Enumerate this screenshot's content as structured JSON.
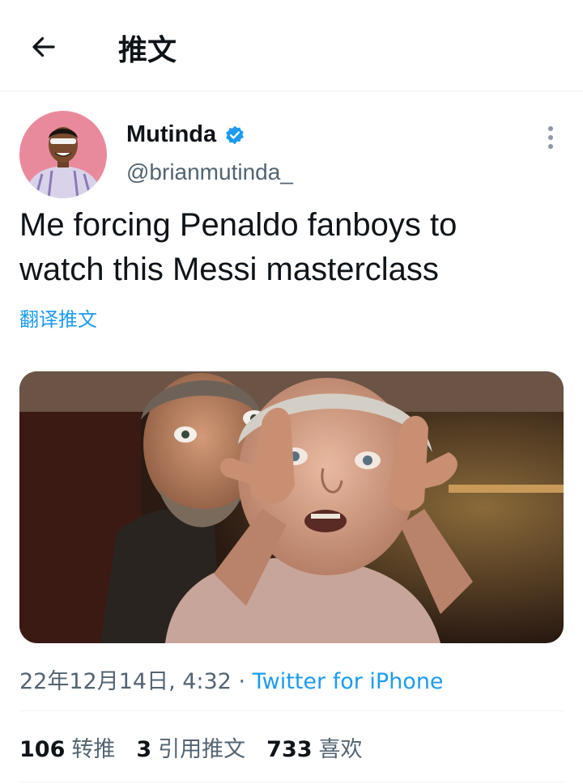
{
  "header": {
    "title": "推文",
    "back_icon": "arrow-left-icon"
  },
  "tweet": {
    "author": {
      "name": "Mutinda",
      "handle": "@brianmutinda_",
      "verified": true
    },
    "text_line1": "Me forcing Penaldo fanboys to",
    "text_line2": "watch this Messi masterclass",
    "translate_label": "翻译推文",
    "timestamp": "22年12月14日, 4:32",
    "separator": " · ",
    "source": "Twitter for iPhone"
  },
  "stats": {
    "retweets": {
      "count": "106",
      "label": "转推"
    },
    "quotes": {
      "count": "3",
      "label": "引用推文"
    },
    "likes": {
      "count": "733",
      "label": "喜欢"
    }
  },
  "colors": {
    "accent": "#1d9bf0",
    "secondary_text": "#536471",
    "avatar_bg": "#e98a9c"
  }
}
